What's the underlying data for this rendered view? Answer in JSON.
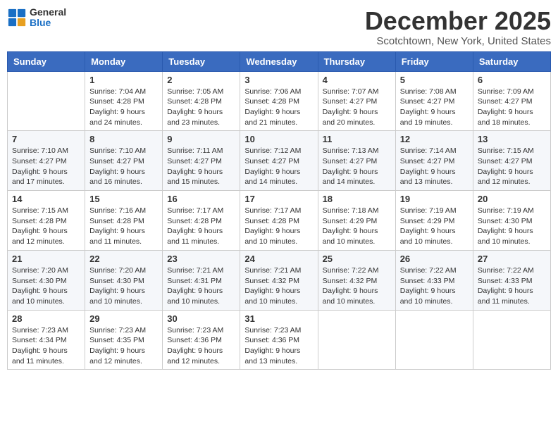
{
  "header": {
    "logo_general": "General",
    "logo_blue": "Blue",
    "month_title": "December 2025",
    "subtitle": "Scotchtown, New York, United States"
  },
  "weekdays": [
    "Sunday",
    "Monday",
    "Tuesday",
    "Wednesday",
    "Thursday",
    "Friday",
    "Saturday"
  ],
  "weeks": [
    [
      {
        "day": "",
        "info": ""
      },
      {
        "day": "1",
        "info": "Sunrise: 7:04 AM\nSunset: 4:28 PM\nDaylight: 9 hours\nand 24 minutes."
      },
      {
        "day": "2",
        "info": "Sunrise: 7:05 AM\nSunset: 4:28 PM\nDaylight: 9 hours\nand 23 minutes."
      },
      {
        "day": "3",
        "info": "Sunrise: 7:06 AM\nSunset: 4:28 PM\nDaylight: 9 hours\nand 21 minutes."
      },
      {
        "day": "4",
        "info": "Sunrise: 7:07 AM\nSunset: 4:27 PM\nDaylight: 9 hours\nand 20 minutes."
      },
      {
        "day": "5",
        "info": "Sunrise: 7:08 AM\nSunset: 4:27 PM\nDaylight: 9 hours\nand 19 minutes."
      },
      {
        "day": "6",
        "info": "Sunrise: 7:09 AM\nSunset: 4:27 PM\nDaylight: 9 hours\nand 18 minutes."
      }
    ],
    [
      {
        "day": "7",
        "info": "Sunrise: 7:10 AM\nSunset: 4:27 PM\nDaylight: 9 hours\nand 17 minutes."
      },
      {
        "day": "8",
        "info": "Sunrise: 7:10 AM\nSunset: 4:27 PM\nDaylight: 9 hours\nand 16 minutes."
      },
      {
        "day": "9",
        "info": "Sunrise: 7:11 AM\nSunset: 4:27 PM\nDaylight: 9 hours\nand 15 minutes."
      },
      {
        "day": "10",
        "info": "Sunrise: 7:12 AM\nSunset: 4:27 PM\nDaylight: 9 hours\nand 14 minutes."
      },
      {
        "day": "11",
        "info": "Sunrise: 7:13 AM\nSunset: 4:27 PM\nDaylight: 9 hours\nand 14 minutes."
      },
      {
        "day": "12",
        "info": "Sunrise: 7:14 AM\nSunset: 4:27 PM\nDaylight: 9 hours\nand 13 minutes."
      },
      {
        "day": "13",
        "info": "Sunrise: 7:15 AM\nSunset: 4:27 PM\nDaylight: 9 hours\nand 12 minutes."
      }
    ],
    [
      {
        "day": "14",
        "info": "Sunrise: 7:15 AM\nSunset: 4:28 PM\nDaylight: 9 hours\nand 12 minutes."
      },
      {
        "day": "15",
        "info": "Sunrise: 7:16 AM\nSunset: 4:28 PM\nDaylight: 9 hours\nand 11 minutes."
      },
      {
        "day": "16",
        "info": "Sunrise: 7:17 AM\nSunset: 4:28 PM\nDaylight: 9 hours\nand 11 minutes."
      },
      {
        "day": "17",
        "info": "Sunrise: 7:17 AM\nSunset: 4:28 PM\nDaylight: 9 hours\nand 10 minutes."
      },
      {
        "day": "18",
        "info": "Sunrise: 7:18 AM\nSunset: 4:29 PM\nDaylight: 9 hours\nand 10 minutes."
      },
      {
        "day": "19",
        "info": "Sunrise: 7:19 AM\nSunset: 4:29 PM\nDaylight: 9 hours\nand 10 minutes."
      },
      {
        "day": "20",
        "info": "Sunrise: 7:19 AM\nSunset: 4:30 PM\nDaylight: 9 hours\nand 10 minutes."
      }
    ],
    [
      {
        "day": "21",
        "info": "Sunrise: 7:20 AM\nSunset: 4:30 PM\nDaylight: 9 hours\nand 10 minutes."
      },
      {
        "day": "22",
        "info": "Sunrise: 7:20 AM\nSunset: 4:30 PM\nDaylight: 9 hours\nand 10 minutes."
      },
      {
        "day": "23",
        "info": "Sunrise: 7:21 AM\nSunset: 4:31 PM\nDaylight: 9 hours\nand 10 minutes."
      },
      {
        "day": "24",
        "info": "Sunrise: 7:21 AM\nSunset: 4:32 PM\nDaylight: 9 hours\nand 10 minutes."
      },
      {
        "day": "25",
        "info": "Sunrise: 7:22 AM\nSunset: 4:32 PM\nDaylight: 9 hours\nand 10 minutes."
      },
      {
        "day": "26",
        "info": "Sunrise: 7:22 AM\nSunset: 4:33 PM\nDaylight: 9 hours\nand 10 minutes."
      },
      {
        "day": "27",
        "info": "Sunrise: 7:22 AM\nSunset: 4:33 PM\nDaylight: 9 hours\nand 11 minutes."
      }
    ],
    [
      {
        "day": "28",
        "info": "Sunrise: 7:23 AM\nSunset: 4:34 PM\nDaylight: 9 hours\nand 11 minutes."
      },
      {
        "day": "29",
        "info": "Sunrise: 7:23 AM\nSunset: 4:35 PM\nDaylight: 9 hours\nand 12 minutes."
      },
      {
        "day": "30",
        "info": "Sunrise: 7:23 AM\nSunset: 4:36 PM\nDaylight: 9 hours\nand 12 minutes."
      },
      {
        "day": "31",
        "info": "Sunrise: 7:23 AM\nSunset: 4:36 PM\nDaylight: 9 hours\nand 13 minutes."
      },
      {
        "day": "",
        "info": ""
      },
      {
        "day": "",
        "info": ""
      },
      {
        "day": "",
        "info": ""
      }
    ]
  ]
}
